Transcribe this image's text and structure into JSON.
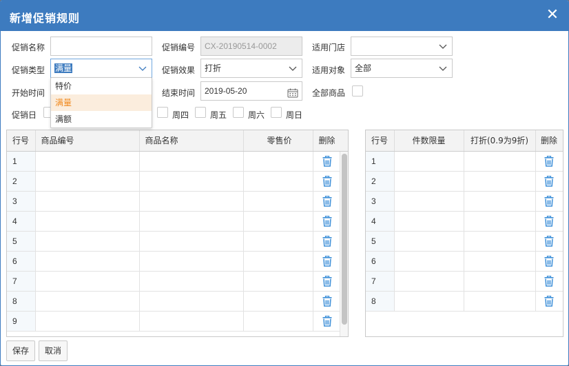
{
  "dialog": {
    "title": "新增促销规则",
    "close_glyph": "✕"
  },
  "form": {
    "name_label": "促销名称",
    "name_value": "",
    "code_label": "促销编号",
    "code_value": "CX-20190514-0002",
    "store_label": "适用门店",
    "store_value": "",
    "type_label": "促销类型",
    "type_value": "满量",
    "effect_label": "促销效果",
    "effect_value": "打折",
    "target_label": "适用对象",
    "target_value": "全部",
    "start_label": "开始时间",
    "end_label": "结束时间",
    "end_value": "2019-05-20",
    "all_goods_label": "全部商品",
    "days_label": "促销日",
    "days": [
      "周四",
      "周五",
      "周六",
      "周日"
    ]
  },
  "type_dropdown": {
    "options": [
      "特价",
      "满量",
      "满额"
    ],
    "active_index": 1
  },
  "goods_table": {
    "headers": [
      "行号",
      "商品编号",
      "商品名称",
      "零售价",
      "删除"
    ],
    "rows": [
      "1",
      "2",
      "3",
      "4",
      "5",
      "6",
      "7",
      "8",
      "9"
    ]
  },
  "rule_table": {
    "headers": [
      "行号",
      "件数限量",
      "打折(0.9为9折)",
      "删除"
    ],
    "rows": [
      "1",
      "2",
      "3",
      "4",
      "5",
      "6",
      "7",
      "8"
    ]
  },
  "footer": {
    "save_label": "保存",
    "cancel_label": "取消"
  },
  "colors": {
    "titlebar": "#3d7bbf",
    "accent_orange": "#f08a1f",
    "trash_blue": "#3d8fd8"
  }
}
